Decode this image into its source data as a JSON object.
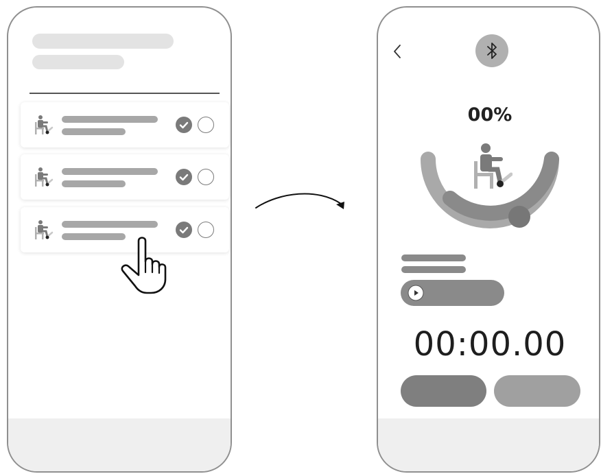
{
  "left_screen": {
    "rows": [
      {
        "seat_icon": "chair-exercise-icon",
        "check_icon": "check-circle-icon",
        "radio_icon": "radio-empty-icon"
      },
      {
        "seat_icon": "chair-exercise-icon",
        "check_icon": "check-circle-icon",
        "radio_icon": "radio-empty-icon"
      },
      {
        "seat_icon": "chair-exercise-icon",
        "check_icon": "check-circle-icon",
        "radio_icon": "radio-empty-icon"
      }
    ],
    "gesture_icon": "tap-hand-icon"
  },
  "transition_icon": "curved-arrow-icon",
  "right_screen": {
    "back_icon": "back-chevron-icon",
    "bluetooth_icon": "bluetooth-icon",
    "progress_text": "00%",
    "progress_value": 0,
    "timer_text": "00:00.00",
    "play_icon": "play-icon"
  },
  "colors": {
    "phone_border": "#8f8f8f",
    "placeholder_light": "#e3e3e3",
    "placeholder_mid": "#a7a7a7",
    "dark_gray": "#7a7a7a",
    "arc_light": "#a9a9a9",
    "arc_dark": "#8a8a8a",
    "footer": "#efefef"
  }
}
